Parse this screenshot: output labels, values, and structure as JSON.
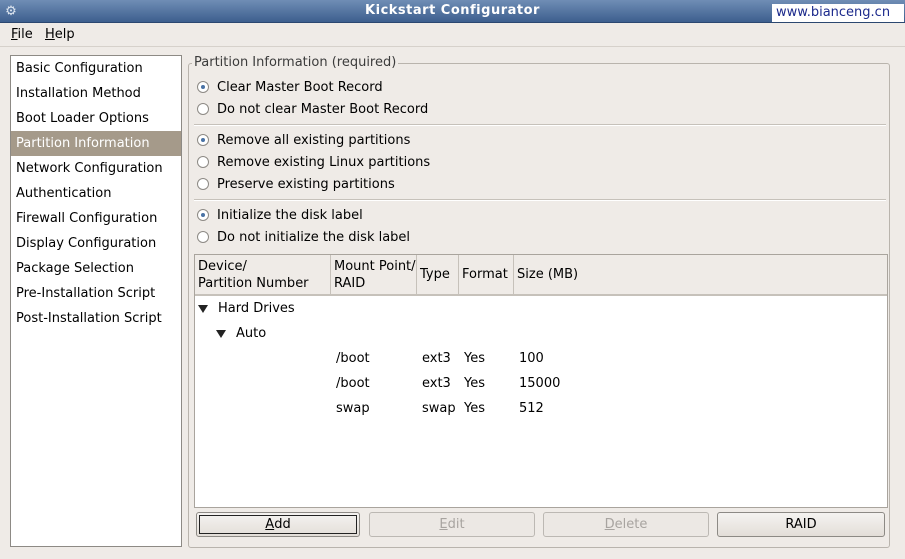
{
  "window": {
    "title": "Kickstart Configurator",
    "watermark": "www.bianceng.cn"
  },
  "menubar": {
    "file": {
      "mnemonic": "F",
      "rest": "ile"
    },
    "help": {
      "mnemonic": "H",
      "rest": "elp"
    }
  },
  "sidebar": {
    "items": [
      {
        "label": "Basic Configuration"
      },
      {
        "label": "Installation Method"
      },
      {
        "label": "Boot Loader Options"
      },
      {
        "label": "Partition Information",
        "selected": true
      },
      {
        "label": "Network Configuration"
      },
      {
        "label": "Authentication"
      },
      {
        "label": "Firewall Configuration"
      },
      {
        "label": "Display Configuration"
      },
      {
        "label": "Package Selection"
      },
      {
        "label": "Pre-Installation Script"
      },
      {
        "label": "Post-Installation Script"
      }
    ]
  },
  "partition": {
    "group_title": "Partition Information (required)",
    "mbr": {
      "clear": {
        "label": "Clear Master Boot Record",
        "checked": true
      },
      "no_clear": {
        "label": "Do not clear Master Boot Record",
        "checked": false
      }
    },
    "existing": {
      "remove_all": {
        "label": "Remove all existing partitions",
        "checked": true
      },
      "remove_linux": {
        "label": "Remove existing Linux partitions",
        "checked": false
      },
      "preserve": {
        "label": "Preserve existing partitions",
        "checked": false
      }
    },
    "disklabel": {
      "init": {
        "label": "Initialize the disk label",
        "checked": true
      },
      "no_init": {
        "label": "Do not initialize the disk label",
        "checked": false
      }
    }
  },
  "table": {
    "headers": {
      "device_line1": "Device/",
      "device_line2": "Partition Number",
      "mount_line1": "Mount Point/",
      "mount_line2": "RAID",
      "type": "Type",
      "format": "Format",
      "size": "Size (MB)"
    },
    "tree": {
      "root": "Hard Drives",
      "child": "Auto"
    },
    "rows": [
      {
        "mount": "/boot",
        "type": "ext3",
        "format": "Yes",
        "size": "100"
      },
      {
        "mount": "/boot",
        "type": "ext3",
        "format": "Yes",
        "size": "15000"
      },
      {
        "mount": "swap",
        "type": "swap",
        "format": "Yes",
        "size": "512"
      }
    ]
  },
  "buttons": {
    "add": {
      "mnemonic": "A",
      "rest": "dd"
    },
    "edit": {
      "mnemonic": "E",
      "rest": "dit"
    },
    "delete": {
      "mnemonic": "D",
      "rest": "elete"
    },
    "raid": {
      "label": "RAID"
    }
  }
}
